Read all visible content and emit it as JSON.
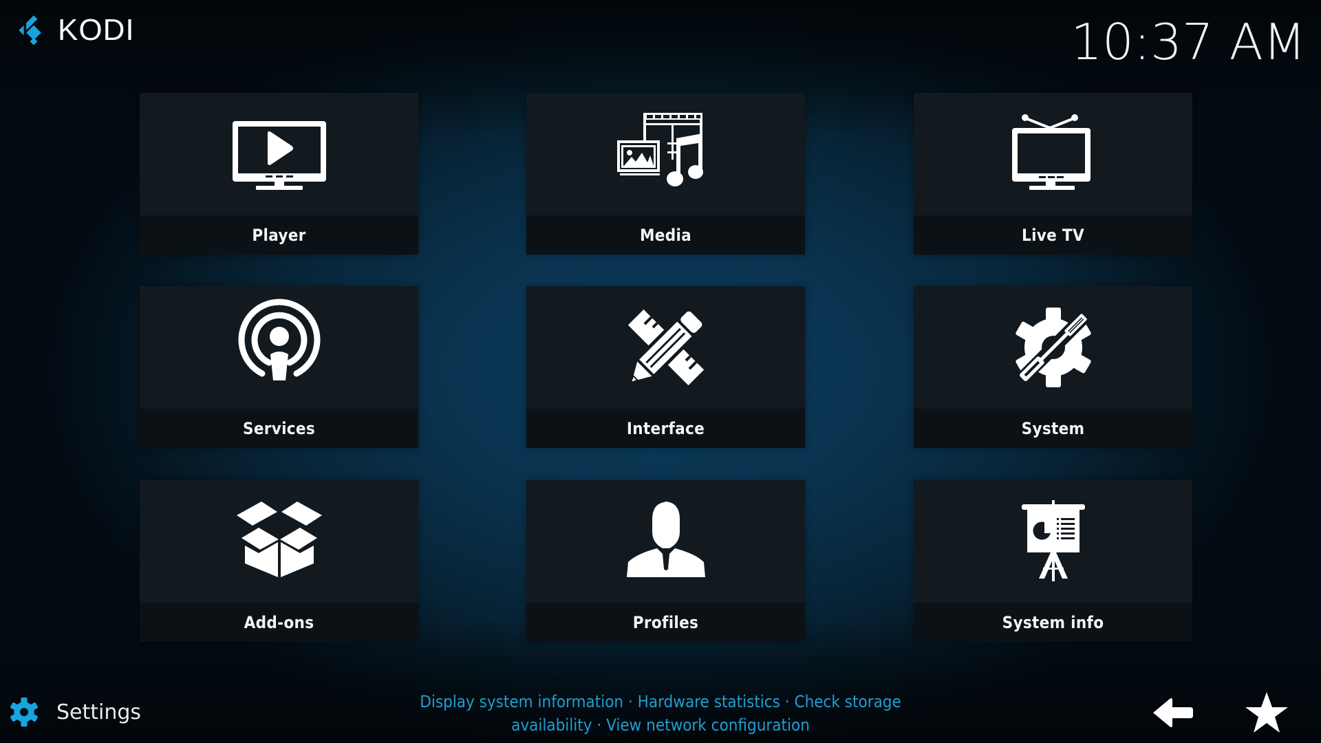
{
  "app": {
    "name": "KODI",
    "accent_color": "#17a5dd"
  },
  "header": {
    "clock": "10:37 AM"
  },
  "tiles": [
    {
      "label": "Player",
      "icon": "monitor-play-icon"
    },
    {
      "label": "Media",
      "icon": "media-library-icon"
    },
    {
      "label": "Live TV",
      "icon": "tv-antenna-icon"
    },
    {
      "label": "Services",
      "icon": "broadcast-icon"
    },
    {
      "label": "Interface",
      "icon": "pencil-ruler-icon"
    },
    {
      "label": "System",
      "icon": "gear-screwdriver-icon"
    },
    {
      "label": "Add-ons",
      "icon": "open-box-icon"
    },
    {
      "label": "Profiles",
      "icon": "user-icon"
    },
    {
      "label": "System info",
      "icon": "presentation-icon"
    }
  ],
  "footer": {
    "section_label": "Settings",
    "section_icon": "gear-icon",
    "description_line1": "Display system information · Hardware statistics · Check storage",
    "description_line2": "availability · View network configuration",
    "description_color": "#1e9fd3",
    "back_icon": "back-arrow-icon",
    "favourites_icon": "star-icon"
  }
}
